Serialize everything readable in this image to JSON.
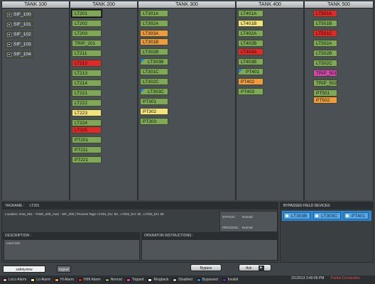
{
  "tanks": {
    "t100": {
      "title": "TANK 100",
      "sif": [
        "SIF_100",
        "SIF_101",
        "SIF_102",
        "SIF_103",
        "SIF_104"
      ]
    },
    "t200": {
      "title": "TANK 200",
      "tags": [
        "LT201",
        "LT202",
        "LT203",
        "TRIP_201",
        "LT211",
        "LT212",
        "LT213",
        "LT214",
        "LT221",
        "LT222",
        "LT223",
        "LT224",
        "LT225",
        "PT201",
        "PT211",
        "PT221"
      ]
    },
    "t300": {
      "title": "TANK 300",
      "tags": [
        "LT301A",
        "LT302A",
        "LT303A",
        "LT301B",
        "LT302B",
        "LT303B",
        "LT301C",
        "LT302C",
        "LT303C",
        "PT301",
        "PT302",
        "PT303"
      ]
    },
    "t400": {
      "title": "TANK 400",
      "tags": [
        "LT401A",
        "LT401B",
        "LT402A",
        "LT402B",
        "LT403A",
        "LT403B",
        "PT401",
        "PT402",
        "PT403"
      ]
    },
    "t500": {
      "title": "TANK 500",
      "tags": [
        "LT501A",
        "LT501B",
        "LT501C",
        "LT502A",
        "LT502B",
        "LT502C",
        "TRIP_501",
        "TRIP_502",
        "PT501",
        "PT502"
      ]
    }
  },
  "detail": {
    "tagname_label": "TAGNAME :",
    "tagname_value": "LT201",
    "location_text": "Location: Area_001 - TANK_200_Auto - SIF_200  |  Process Tags: LT201_EU: 50 , LT202_EU: 50 , LT203_EU: 50",
    "status_label": "STATUS :",
    "status_value": "Normal",
    "process_label": "PROCESS :",
    "process_value": "Normal",
    "description_label": "DESCRIPTION :",
    "description_value": "Level 201",
    "instructions_label": "OPERATOR INSTRUCTIONS :"
  },
  "bypass": {
    "title": "BYPASSED FIELD DEVICES",
    "items": [
      "LT303B",
      "LT303C",
      "PT401"
    ]
  },
  "tabs": {
    "safetyview": "safetyview",
    "logout": "logout"
  },
  "buttons": {
    "bypass": "Bypass",
    "ack": "Ack"
  },
  "legend": [
    "LoLo Alarm",
    "Lo Alarm",
    "Hi Alarm",
    "HiHi Alarm",
    "Normal",
    "Tripped",
    "Ringback",
    "Disabled",
    "Bypassed",
    "Invalid"
  ],
  "legend_colors": [
    "#f0a0c0",
    "#f6e27a",
    "#f29b3d",
    "#e02a2a",
    "#7ea855",
    "#d944b0",
    "#ffffff",
    "#bdbdbd",
    "#2a7fd4",
    "#6a2a9a"
  ],
  "datetime": "2/1/2013 3:40:06 PM",
  "connection": "Partial Connection"
}
